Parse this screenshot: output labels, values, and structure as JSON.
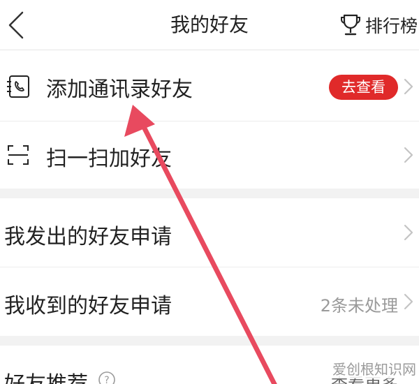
{
  "header": {
    "title": "我的好友",
    "rank_label": "排行榜"
  },
  "rows": {
    "contacts": {
      "label": "添加通讯录好友",
      "badge": "去查看"
    },
    "scan": {
      "label": "扫一扫加好友"
    },
    "sent_requests": {
      "label": "我发出的好友申请"
    },
    "received_requests": {
      "label": "我收到的好友申请",
      "status": "2条未处理"
    },
    "recommend": {
      "label": "好友推荐",
      "action": "查看更多"
    }
  },
  "watermark": "爱创根知识网",
  "colors": {
    "accent_red": "#e02a2a",
    "arrow": "#e84a5f",
    "gap_gray": "#f2f2f2",
    "muted_text": "#9a9a9a"
  },
  "icons": {
    "back": "chevron-left-icon",
    "rank": "trophy-icon",
    "contacts": "phone-book-icon",
    "scan": "scan-frame-icon",
    "chevron": "chevron-right-icon",
    "help": "question-circle-icon"
  }
}
